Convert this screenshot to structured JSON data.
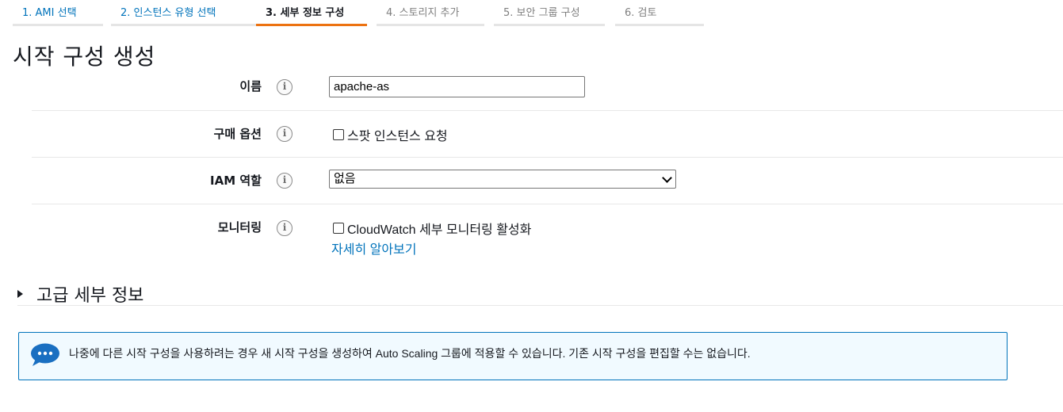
{
  "wizard": {
    "steps": [
      {
        "label": "1. AMI 선택",
        "state": "done"
      },
      {
        "label": "2. 인스턴스 유형 선택",
        "state": "done"
      },
      {
        "label": "3. 세부 정보 구성",
        "state": "active"
      },
      {
        "label": "4. 스토리지 추가",
        "state": "future"
      },
      {
        "label": "5. 보안 그룹 구성",
        "state": "future"
      },
      {
        "label": "6. 검토",
        "state": "future"
      }
    ]
  },
  "page": {
    "title": "시작 구성 생성"
  },
  "form": {
    "name": {
      "label": "이름",
      "value": "apache-as"
    },
    "purchase_option": {
      "label": "구매 옵션",
      "checkbox_label": "스팟 인스턴스 요청",
      "checked": false
    },
    "iam_role": {
      "label": "IAM 역할",
      "selected": "없음"
    },
    "monitoring": {
      "label": "모니터링",
      "checkbox_label": "CloudWatch 세부 모니터링 활성화",
      "checked": false,
      "link": "자세히 알아보기"
    }
  },
  "advanced": {
    "label": "고급 세부 정보",
    "expanded": false
  },
  "info_message": {
    "text": "나중에 다른 시작 구성을 사용하려는 경우 새 시작 구성을 생성하여 Auto Scaling 그룹에 적용할 수 있습니다. 기존 시작 구성을 편집할 수는 없습니다.",
    "icon": "chat-bubble-icon"
  },
  "colors": {
    "accent": "#ec7211",
    "link": "#0073bb",
    "info_border": "#0073bb",
    "info_bg": "#f1faff"
  }
}
